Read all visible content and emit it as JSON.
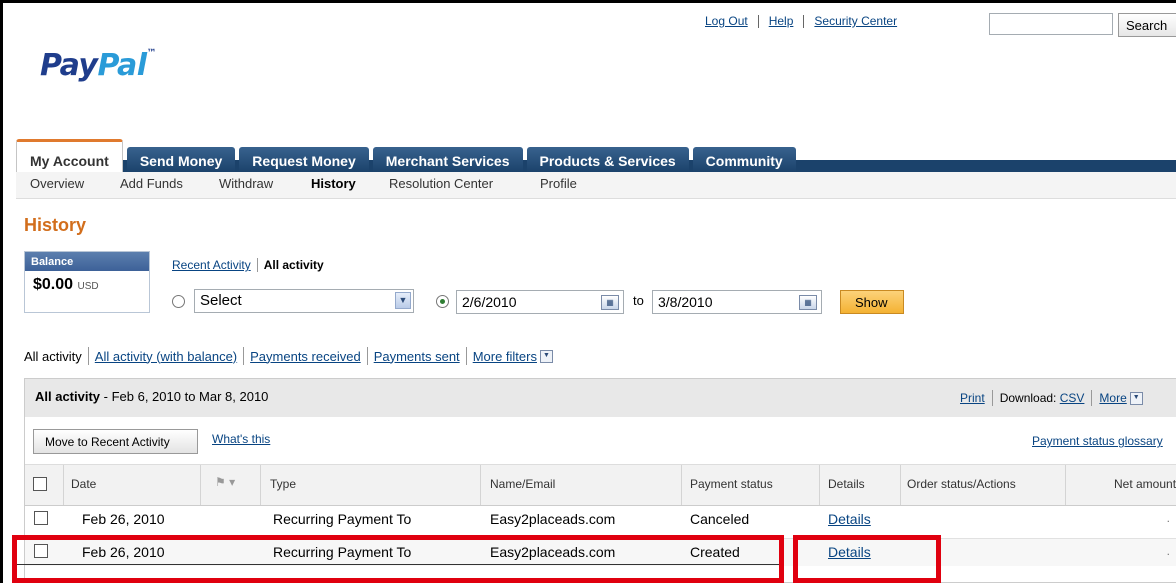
{
  "top_links": {
    "logout": "Log Out",
    "help": "Help",
    "security": "Security Center"
  },
  "search": {
    "button": "Search",
    "value": ""
  },
  "logo": {
    "part1": "Pay",
    "part2": "Pal",
    "tm": "™"
  },
  "nav": {
    "tabs": [
      "My Account",
      "Send Money",
      "Request Money",
      "Merchant Services",
      "Products & Services",
      "Community"
    ],
    "subtabs": [
      "Overview",
      "Add Funds",
      "Withdraw",
      "History",
      "Resolution Center",
      "Profile"
    ]
  },
  "page_title": "History",
  "balance": {
    "label": "Balance",
    "amount": "$0.00",
    "currency": "USD"
  },
  "view": {
    "recent": "Recent Activity",
    "all": "All activity"
  },
  "filter": {
    "select_value": "Select",
    "from_date": "2/6/2010",
    "to_label": "to",
    "to_date": "3/8/2010",
    "show": "Show"
  },
  "filter_links": {
    "current": "All activity",
    "with_balance": "All activity (with balance)",
    "received": "Payments received",
    "sent": "Payments sent",
    "more": "More filters"
  },
  "panel": {
    "title_bold": "All activity",
    "title_range": " - Feb 6, 2010 to Mar 8, 2010",
    "print": "Print",
    "download_label": "Download:",
    "csv": "CSV",
    "more": "More",
    "move_button": "Move to Recent Activity",
    "whats_this": "What's this",
    "glossary": "Payment status glossary"
  },
  "table": {
    "headers": {
      "date": "Date",
      "type": "Type",
      "name": "Name/Email",
      "status": "Payment status",
      "details": "Details",
      "order": "Order status/Actions",
      "net": "Net amount"
    },
    "rows": [
      {
        "date": "Feb 26, 2010",
        "type": "Recurring Payment To",
        "name": "Easy2placeads.com",
        "status": "Canceled",
        "details": "Details",
        "net": "."
      },
      {
        "date": "Feb 26, 2010",
        "type": "Recurring Payment To",
        "name": "Easy2placeads.com",
        "status": "Created",
        "details": "Details",
        "net": "."
      }
    ]
  },
  "colors": {
    "brand_dark": "#1f3d8c",
    "brand_light": "#2a9bd8",
    "nav": "#1b426b",
    "title_orange": "#d26e1c",
    "highlight": "#e0000f"
  }
}
